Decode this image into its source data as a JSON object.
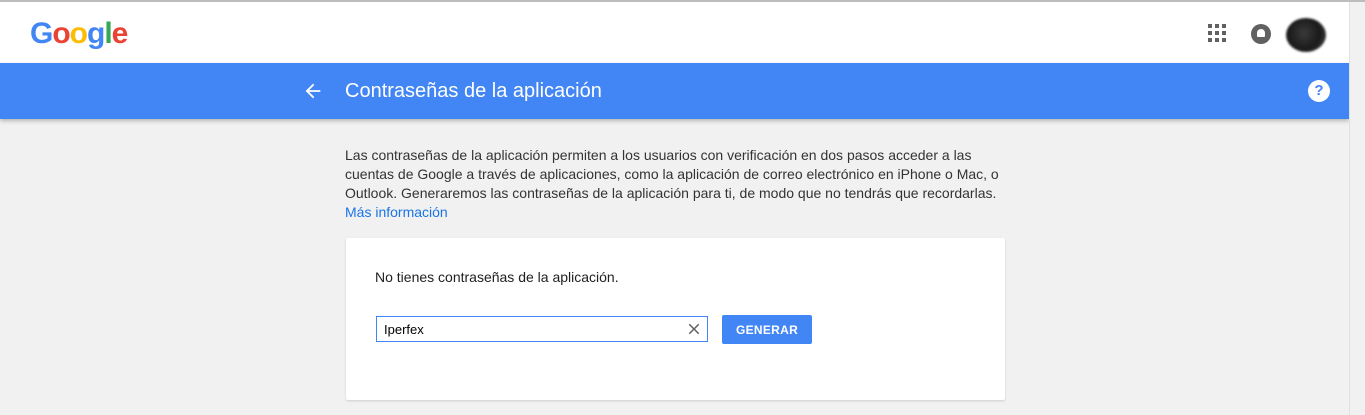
{
  "brand": {
    "letters": [
      {
        "char": "G",
        "color": "#4285f4"
      },
      {
        "char": "o",
        "color": "#ea4335"
      },
      {
        "char": "o",
        "color": "#fbbc05"
      },
      {
        "char": "g",
        "color": "#4285f4"
      },
      {
        "char": "l",
        "color": "#34a853"
      },
      {
        "char": "e",
        "color": "#ea4335"
      }
    ]
  },
  "topbar": {
    "apps_icon": "apps-grid-icon",
    "notifications_icon": "bell-icon",
    "avatar": "avatar"
  },
  "header": {
    "title": "Contraseñas de la aplicación",
    "back_icon": "arrow-left-icon",
    "help_label": "?",
    "color": "#4285f4"
  },
  "main": {
    "description": "Las contraseñas de la aplicación permiten a los usuarios con verificación en dos pasos acceder a las cuentas de Google a través de aplicaciones, como la aplicación de correo electrónico en iPhone o Mac, o Outlook. Generaremos las contraseñas de la aplicación para ti, de modo que no tendrás que recordarlas.",
    "more_info_link": "Más información"
  },
  "card": {
    "empty_message": "No tienes contraseñas de la aplicación.",
    "app_name_input": {
      "value": "Iperfex",
      "placeholder": ""
    },
    "clear_icon": "close-icon",
    "generate_label": "GENERAR"
  }
}
